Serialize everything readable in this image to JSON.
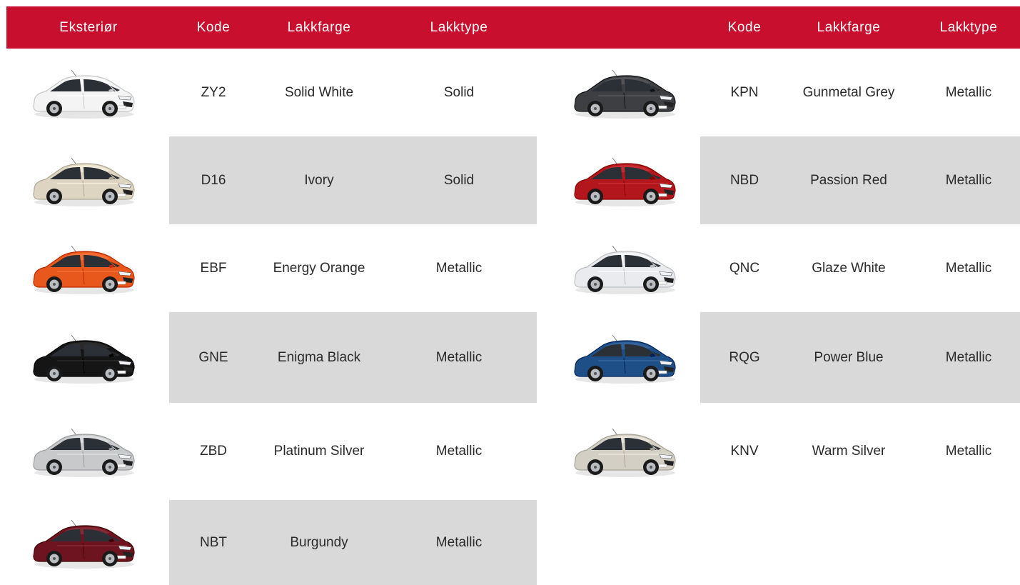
{
  "header": {
    "exterior": "Eksteriør",
    "left_code": "Kode",
    "left_color": "Lakkfarge",
    "left_type": "Lakktype",
    "right_code": "Kode",
    "right_color": "Lakkfarge",
    "right_type": "Lakktype"
  },
  "colors": {
    "header_bg": "#c8102e",
    "stripe_bg": "#d9d9d9"
  },
  "left_rows": [
    {
      "code": "ZY2",
      "color": "Solid White",
      "type": "Solid",
      "paint": "#f4f4f4",
      "striped": false
    },
    {
      "code": "D16",
      "color": "Ivory",
      "type": "Solid",
      "paint": "#ddd5c2",
      "striped": true
    },
    {
      "code": "EBF",
      "color": "Energy Orange",
      "type": "Metallic",
      "paint": "#e8571c",
      "striped": false
    },
    {
      "code": "GNE",
      "color": "Enigma Black",
      "type": "Metallic",
      "paint": "#151515",
      "striped": true
    },
    {
      "code": "ZBD",
      "color": "Platinum Silver",
      "type": "Metallic",
      "paint": "#c7c9cb",
      "striped": false
    },
    {
      "code": "NBT",
      "color": "Burgundy",
      "type": "Metallic",
      "paint": "#6e1420",
      "striped": true
    }
  ],
  "right_rows": [
    {
      "code": "KPN",
      "color": "Gunmetal Grey",
      "type": "Metallic",
      "paint": "#3d3f42",
      "striped": false
    },
    {
      "code": "NBD",
      "color": "Passion Red",
      "type": "Metallic",
      "paint": "#b3161c",
      "striped": true
    },
    {
      "code": "QNC",
      "color": "Glaze White",
      "type": "Metallic",
      "paint": "#e9ebee",
      "striped": false
    },
    {
      "code": "RQG",
      "color": "Power Blue",
      "type": "Metallic",
      "paint": "#1e4f86",
      "striped": true
    },
    {
      "code": "KNV",
      "color": "Warm Silver",
      "type": "Metallic",
      "paint": "#d4cfc4",
      "striped": false
    }
  ],
  "icons": {
    "car": "car-image-icon"
  }
}
